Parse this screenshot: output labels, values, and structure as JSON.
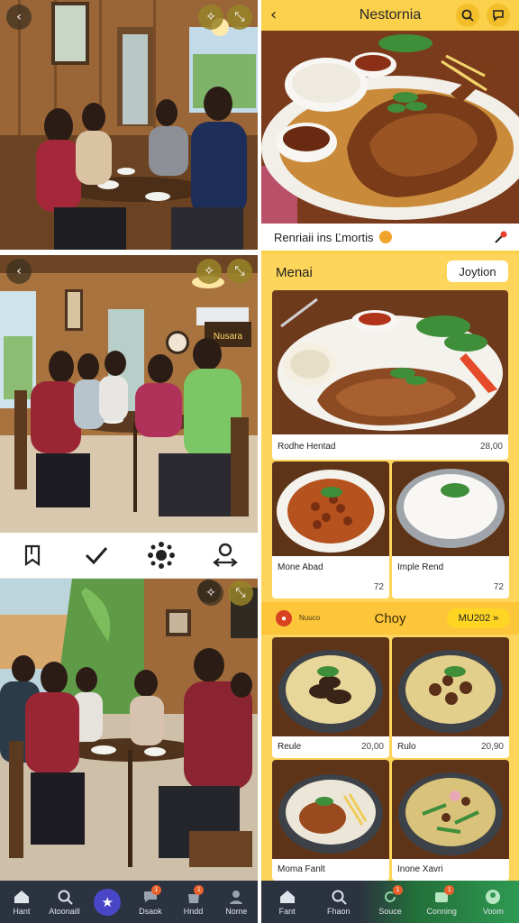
{
  "left": {
    "overlay_buttons": {
      "back": "back-arrow-icon",
      "sparkle": "sparkle-icon",
      "expand": "expand-icon"
    },
    "action_bar": [
      "bookmark-icon",
      "checkmark-icon",
      "connect-dots-icon",
      "person-transfer-icon"
    ],
    "restaurant_sign": "Nusara",
    "nav": [
      {
        "label": "Hant",
        "icon": "home-icon",
        "badge": ""
      },
      {
        "label": "Atoonaill",
        "icon": "search-icon",
        "badge": ""
      },
      {
        "label": "",
        "icon": "star-icon",
        "badge": ""
      },
      {
        "label": "Dsaok",
        "icon": "chat-icon",
        "badge": "1"
      },
      {
        "label": "Hndd",
        "icon": "bag-icon",
        "badge": "1"
      },
      {
        "label": "Nome",
        "icon": "user-icon",
        "badge": ""
      }
    ]
  },
  "right": {
    "header": {
      "title": "Nestornia",
      "back_icon": "back-chevron-icon",
      "search_icon": "search-icon",
      "chat_icon": "chat-icon"
    },
    "hero_caption": "Renriaii ins Ľmortis",
    "menu": {
      "title": "Menai",
      "button": "Joytion",
      "featured": {
        "name": "Rodhe Hentad",
        "price": "28,00"
      },
      "items": [
        {
          "name": "Mone Abad",
          "price": "72"
        },
        {
          "name": "Imple Rend",
          "price": "72"
        }
      ]
    },
    "choy": {
      "small_label": "Nuuco",
      "title": "Choy",
      "pill": "MU202 »",
      "items": [
        {
          "name": "Reule",
          "price": "20,00"
        },
        {
          "name": "Rulo",
          "price": "20,90"
        },
        {
          "name": "Moma Fanlt",
          "price": ""
        },
        {
          "name": "Inone Xavri",
          "price": ""
        }
      ]
    },
    "nav": [
      {
        "label": "Fant",
        "icon": "home-icon",
        "badge": ""
      },
      {
        "label": "Fhaon",
        "icon": "search-icon",
        "badge": ""
      },
      {
        "label": "Souce",
        "icon": "refresh-icon",
        "badge": "1"
      },
      {
        "label": "Conning",
        "icon": "wallet-icon",
        "badge": "1"
      },
      {
        "label": "Voom",
        "icon": "user-icon",
        "badge": ""
      }
    ]
  },
  "colors": {
    "accent_yellow": "#fbd04a",
    "nav_dark": "#2c3340",
    "nav_green": "#2e9a52",
    "nav_center": "#4a46c8",
    "badge": "#e8612c"
  }
}
